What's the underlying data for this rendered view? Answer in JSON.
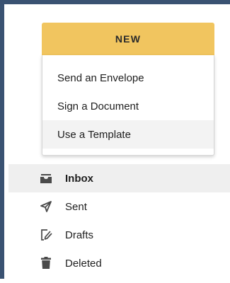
{
  "new_button": {
    "label": "NEW"
  },
  "new_menu": {
    "items": [
      {
        "label": "Send an Envelope",
        "highlighted": false
      },
      {
        "label": "Sign a Document",
        "highlighted": false
      },
      {
        "label": "Use a Template",
        "highlighted": true
      }
    ]
  },
  "nav": {
    "items": [
      {
        "label": "Inbox",
        "icon": "inbox-icon",
        "active": true
      },
      {
        "label": "Sent",
        "icon": "paper-plane-icon",
        "active": false
      },
      {
        "label": "Drafts",
        "icon": "draft-edit-icon",
        "active": false
      },
      {
        "label": "Deleted",
        "icon": "trash-icon",
        "active": false
      }
    ]
  },
  "colors": {
    "new_button_bg": "#f1c55f",
    "frame_border": "#3a5272",
    "highlight_bg": "#f3f3f3",
    "active_row_bg": "#efefef",
    "icon_color": "#4a4a4a"
  }
}
